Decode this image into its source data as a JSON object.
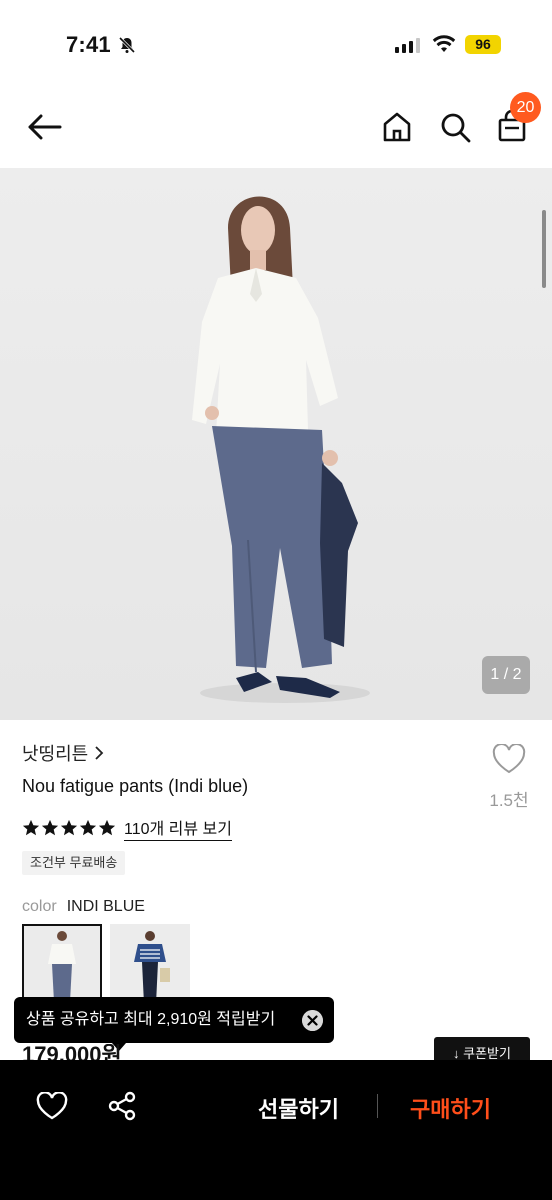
{
  "status_bar": {
    "time": "7:41",
    "battery": "96"
  },
  "header": {
    "cart_count": "20"
  },
  "gallery": {
    "counter": "1 / 2"
  },
  "product": {
    "brand": "낫띵리튼",
    "name": "Nou fatigue pants (Indi blue)",
    "like_count": "1.5천",
    "rating_stars": 5,
    "review_link": "110개 리뷰 보기",
    "shipping_badge": "조건부 무료배송",
    "color_label": "color",
    "color_value": "INDI BLUE",
    "price_partial": "179,000원"
  },
  "toast": {
    "text": "상품 공유하고 최대 2,910원 적립받기"
  },
  "coupon_button": {
    "label": "↓ 쿠폰받기"
  },
  "bottom_bar": {
    "gift_label": "선물하기",
    "buy_label": "구매하기"
  },
  "colors": {
    "accent": "#ff4e1a",
    "badge": "#ff5a1f",
    "battery": "#f2d400"
  }
}
